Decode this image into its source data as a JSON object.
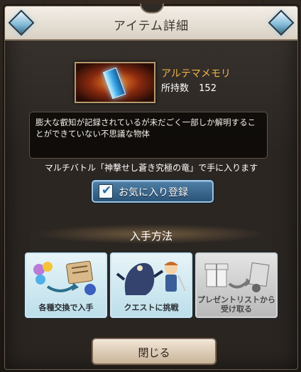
{
  "header": {
    "title": "アイテム詳細"
  },
  "item": {
    "name": "アルテマメモリ",
    "owned_label": "所持数",
    "owned_count": "152",
    "description": "膨大な叡知が記録されているが未だごく一部しか解明することができていない不思議な物体"
  },
  "source": {
    "text": "マルチバトル「神撃せし蒼き究極の竜」で手に入ります"
  },
  "favorite": {
    "label": "お気に入り登録",
    "checked": true
  },
  "methods": {
    "title": "入手方法",
    "cards": [
      {
        "label": "各種交換で入手",
        "icon": "exchange-icon"
      },
      {
        "label": "クエストに挑戦",
        "icon": "quest-icon"
      },
      {
        "label_line1": "プレゼントリストから",
        "label_line2": "受け取る",
        "icon": "present-icon",
        "disabled": true
      }
    ]
  },
  "close": {
    "label": "閉じる"
  },
  "colors": {
    "accent_gold": "#f0b24a",
    "button_blue": "#2b5378"
  }
}
